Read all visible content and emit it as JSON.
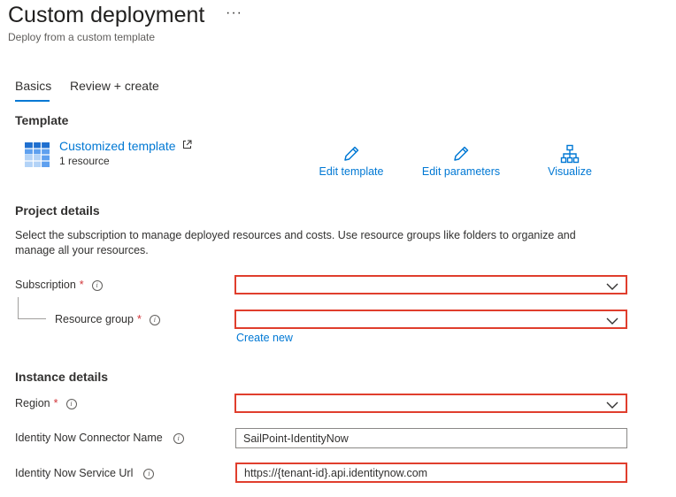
{
  "header": {
    "title": "Custom deployment",
    "more": "···",
    "subtitle": "Deploy from a custom template"
  },
  "tabs": [
    {
      "label": "Basics",
      "selected": true
    },
    {
      "label": "Review + create",
      "selected": false
    }
  ],
  "template": {
    "heading": "Template",
    "name": "Customized template",
    "resources": "1 resource",
    "actions": {
      "edit_template": "Edit template",
      "edit_parameters": "Edit parameters",
      "visualize": "Visualize"
    }
  },
  "project": {
    "heading": "Project details",
    "description": "Select the subscription to manage deployed resources and costs. Use resource groups like folders to organize and manage all your resources.",
    "subscription_label": "Subscription",
    "resource_group_label": "Resource group",
    "create_new": "Create new",
    "required_mark": "*"
  },
  "instance": {
    "heading": "Instance details",
    "region_label": "Region",
    "connector_name_label": "Identity Now Connector Name",
    "connector_name_value": "SailPoint-IdentityNow",
    "service_url_label": "Identity Now Service Url",
    "service_url_value": "https://{tenant-id}.api.identitynow.com"
  },
  "colors": {
    "accent": "#0078d4",
    "error_border": "#e03e2d",
    "required": "#d13438"
  },
  "icons": {
    "info": "i"
  }
}
